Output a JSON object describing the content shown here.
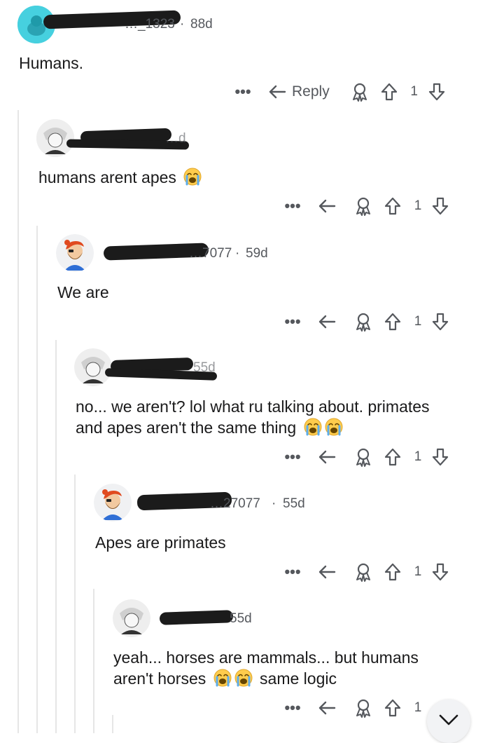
{
  "comments": [
    {
      "id": "c1",
      "username": "…_1323",
      "age": "88d",
      "text": "Humans.",
      "reply_label": "Reply",
      "votes": "1",
      "emojis": []
    },
    {
      "id": "c2",
      "username": "",
      "age": "…d",
      "text": "humans arent apes",
      "reply_label": "",
      "votes": "1",
      "emojis": [
        "loudly-crying-face"
      ]
    },
    {
      "id": "c3",
      "username": "…7077",
      "age": "59d",
      "text": "We are",
      "reply_label": "",
      "votes": "1",
      "emojis": []
    },
    {
      "id": "c4",
      "username": "",
      "age": "55d",
      "text_line1": "no... we aren't? lol what ru talking about. primates",
      "text_line2": "and apes aren't the same thing",
      "reply_label": "",
      "votes": "1",
      "emojis": [
        "loudly-crying-face",
        "loudly-crying-face"
      ]
    },
    {
      "id": "c5",
      "username": "…27077",
      "age": "55d",
      "text": "Apes are primates",
      "reply_label": "",
      "votes": "1",
      "emojis": []
    },
    {
      "id": "c6",
      "username": "",
      "age": "55d",
      "text_line1": "yeah... horses are mammals... but humans",
      "text_line2a": "aren't horses",
      "text_line2b": "same logic",
      "reply_label": "",
      "votes": "1",
      "emojis": [
        "loudly-crying-face",
        "loudly-crying-face"
      ]
    }
  ],
  "ui": {
    "more_icon": "ellipsis-icon",
    "reply_icon": "reply-arrow-icon",
    "award_icon": "award-icon",
    "upvote_icon": "upvote-arrow-icon",
    "downvote_icon": "downvote-arrow-icon",
    "scroll_button_icon": "chevron-down-icon",
    "dots": "•••",
    "separator": "·"
  },
  "colors": {
    "text": "#1a1a1b",
    "meta": "#55585d",
    "thread_line": "#e6e6e6",
    "avatar_bg": "#f0f1f3"
  }
}
